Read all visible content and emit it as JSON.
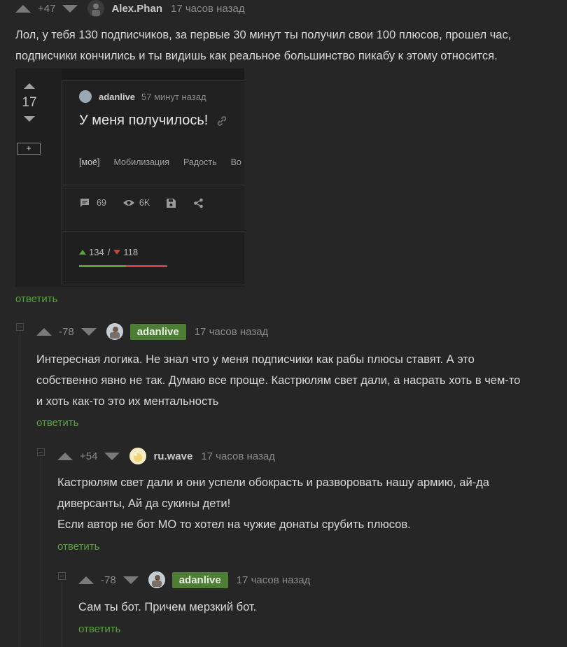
{
  "comments": [
    {
      "rating": "+47",
      "user": "Alex.Phan",
      "time": "17 часов назад",
      "text": "Лол, у тебя 130 подписчиков, за первые 30 минут ты получил свои 100 плюсов, прошел час,\nподписчики кончились и ты видишь как реальное большинство пикабу к этому относится.",
      "reply": "ответить"
    },
    {
      "rating": "-78",
      "user": "adanlive",
      "time": "17 часов назад",
      "text": "Интересная логика. Не знал что у меня подписчики как рабы плюсы ставят. А это\nсобственно явно не так. Думаю все проще. Кастрюлям свет дали, а насрать хоть в чем-то\nи хоть как-то это их ментальность",
      "reply": "ответить"
    },
    {
      "rating": "+54",
      "user": "ru.wave",
      "time": "17 часов назад",
      "text": "Кастрюлям свет дали и они успели обокрасть и разворовать нашу армию, ай-да\nдиверсанты, Ай да сукины дети!\nЕсли автор не бот МО то хотел на чужие донаты срубить плюсов.",
      "reply": "ответить"
    },
    {
      "rating": "-78",
      "user": "adanlive",
      "time": "17 часов назад",
      "text": "Сам ты бот. Причем мерзкий бот.",
      "reply": "ответить"
    }
  ],
  "embedded": {
    "rating": "17",
    "plus": "+",
    "author": "adanlive",
    "time": "57 минут назад",
    "title": "У меня получилось!",
    "tags": [
      "[моё]",
      "Мобилизация",
      "Радость",
      "Во"
    ],
    "comments_count": "69",
    "views": "6K",
    "votes_up": "134",
    "votes_sep": "/",
    "votes_down": "118"
  },
  "colors": {
    "background": "#262626",
    "op_badge": "#4e7d35",
    "reply_link": "#59a33b",
    "vote_up": "#59a33b",
    "vote_down": "#d04040"
  }
}
